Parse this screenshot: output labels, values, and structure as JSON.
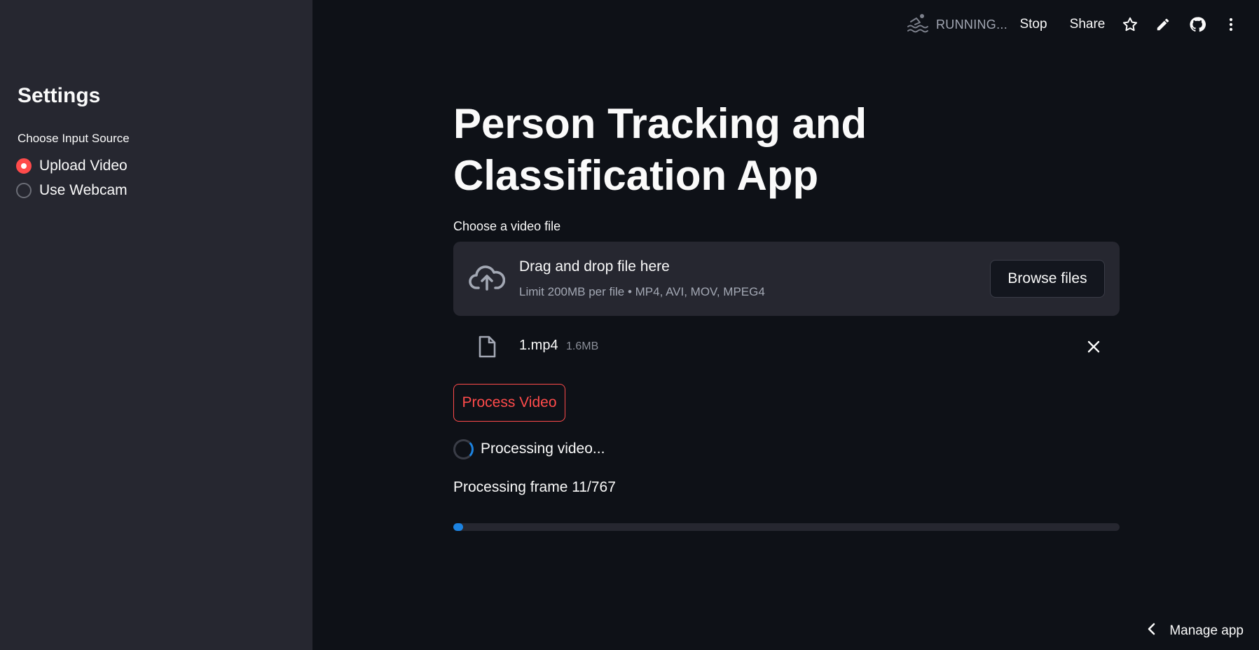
{
  "sidebar": {
    "title": "Settings",
    "radio_label": "Choose Input Source",
    "options": [
      {
        "label": "Upload Video",
        "checked": true
      },
      {
        "label": "Use Webcam",
        "checked": false
      }
    ]
  },
  "toolbar": {
    "status": "RUNNING...",
    "stop_label": "Stop",
    "share_label": "Share",
    "icons": [
      "star-icon",
      "pencil-icon",
      "github-icon",
      "more-vertical-icon"
    ]
  },
  "main": {
    "title": "Person Tracking and Classification App",
    "uploader": {
      "label": "Choose a video file",
      "drop_text": "Drag and drop file here",
      "limit_text": "Limit 200MB per file • MP4, AVI, MOV, MPEG4",
      "browse_label": "Browse files"
    },
    "file": {
      "name": "1.mp4",
      "size": "1.6MB"
    },
    "process_label": "Process Video",
    "spinner_text": "Processing video...",
    "frame_text": "Processing frame 11/767",
    "progress": {
      "current": 11,
      "total": 767
    }
  },
  "footer": {
    "manage_label": "Manage app"
  },
  "colors": {
    "background": "#0e1117",
    "sidebar": "#262730",
    "accent": "#ff4b4b",
    "progress": "#1c83e1"
  }
}
